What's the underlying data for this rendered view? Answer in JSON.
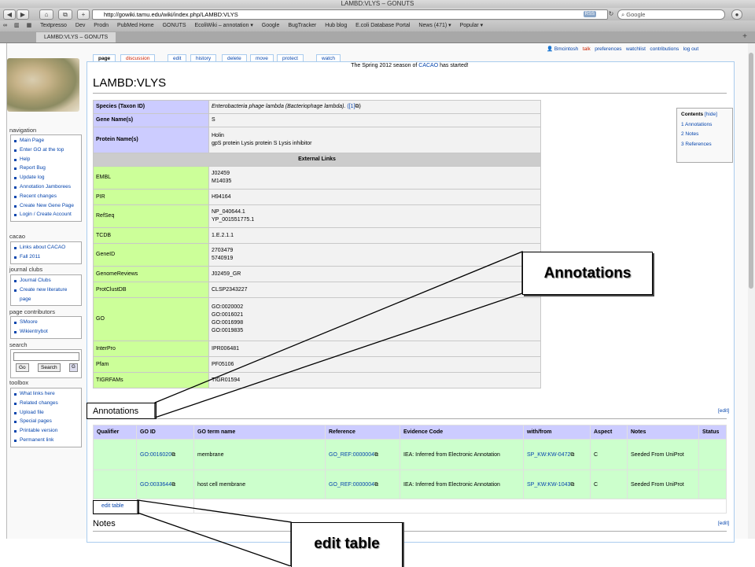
{
  "browser": {
    "window_title": "LAMBD:VLYS – GONUTS",
    "url": "http://gowiki.tamu.edu/wiki/index.php/LAMBD:VLYS",
    "rss": "RSS",
    "search_placeholder": "Google",
    "bookmarks": [
      "Textpresso",
      "Dev",
      "Prodn",
      "PubMed Home",
      "GONUTS",
      "EcoliWiki – annotation ▾",
      "Google",
      "BugTracker",
      "Hub blog",
      "E.coli Database Portal",
      "News (471) ▾",
      "Popular ▾"
    ],
    "tab_label": "LAMBD:VLYS – GONUTS"
  },
  "personal": {
    "user": "Bmcintosh",
    "items": [
      "talk",
      "preferences",
      "watchlist",
      "contributions",
      "log out"
    ]
  },
  "page_tabs": [
    "page",
    "discussion",
    "edit",
    "history",
    "delete",
    "move",
    "protect",
    "watch"
  ],
  "site_notice": {
    "prefix": "The Spring 2012 season of ",
    "link": "CACAO",
    "suffix": " has started!"
  },
  "page_title": "LAMBD:VLYS",
  "sidebar": {
    "navigation": {
      "title": "navigation",
      "items": [
        "Main Page",
        "Enter GO at the top",
        "Help",
        "Report Bug",
        "Update log",
        "Annotation Jamborees",
        "Recent changes",
        "Create New Gene Page",
        "Login / Create Account"
      ]
    },
    "cacao": {
      "title": "cacao",
      "items": [
        "Links about CACAO",
        "Fall 2011"
      ]
    },
    "journal": {
      "title": "journal clubs",
      "items": [
        "Journal Clubs",
        "Create new literature page"
      ]
    },
    "contributors": {
      "title": "page contributors",
      "items": [
        "SMoore",
        "Wikientrybot"
      ]
    },
    "search": {
      "title": "search",
      "go": "Go",
      "search": "Search"
    },
    "toolbox": {
      "title": "toolbox",
      "items": [
        "What links here",
        "Related changes",
        "Upload file",
        "Special pages",
        "Printable version",
        "Permanent link"
      ]
    }
  },
  "infobox": {
    "species_label": "Species (Taxon ID)",
    "species_value": "Enterobacteria phage lambda (Bacteriophage lambda).",
    "species_ref": "([1]",
    "species_ref_close": ")",
    "gene_label": "Gene Name(s)",
    "gene_value": "S",
    "protein_label": "Protein Name(s)",
    "protein_values": [
      "Holin",
      "gpS protein Lysis protein S Lysis inhibitor"
    ],
    "external_links_header": "External Links",
    "links": [
      {
        "label": "EMBL",
        "values": [
          "J02459",
          "M14035"
        ]
      },
      {
        "label": "PIR",
        "values": [
          "H94164"
        ]
      },
      {
        "label": "RefSeq",
        "values": [
          "NP_040644.1",
          "YP_001551775.1"
        ]
      },
      {
        "label": "TCDB",
        "values": [
          "1.E.2.1.1"
        ]
      },
      {
        "label": "GeneID",
        "values": [
          "2703479",
          "5740919"
        ]
      },
      {
        "label": "GenomeReviews",
        "values": [
          "J02459_GR"
        ]
      },
      {
        "label": "ProtClustDB",
        "values": [
          "CLSP2343227"
        ]
      },
      {
        "label": "GO",
        "values": [
          "GO:0020002",
          "GO:0016021",
          "GO:0016998",
          "GO:0019835"
        ]
      },
      {
        "label": "InterPro",
        "values": [
          "IPR006481"
        ]
      },
      {
        "label": "Pfam",
        "values": [
          "PF05106"
        ]
      },
      {
        "label": "TIGRFAMs",
        "values": [
          "TIGR01594"
        ]
      }
    ]
  },
  "toc": {
    "title": "Contents",
    "hide": "[hide]",
    "items": [
      "1 Annotations",
      "2 Notes",
      "3 References"
    ]
  },
  "annotations": {
    "heading": "Annotations",
    "edit": "[edit]",
    "columns": [
      "Qualifier",
      "GO ID",
      "GO term name",
      "Reference",
      "Evidence Code",
      "with/from",
      "Aspect",
      "Notes",
      "Status"
    ],
    "rows": [
      {
        "qualifier": "",
        "go_id": "GO:0016020",
        "term": "membrane",
        "reference": "GO_REF:0000004",
        "evidence": "IEA: Inferred from Electronic Annotation",
        "with_from": "SP_KW:KW-0472",
        "aspect": "C",
        "notes": "Seeded From UniProt",
        "status": ""
      },
      {
        "qualifier": "",
        "go_id": "GO:0033644",
        "term": "host cell membrane",
        "reference": "GO_REF:0000004",
        "evidence": "IEA: Inferred from Electronic Annotation",
        "with_from": "SP_KW:KW-1043",
        "aspect": "C",
        "notes": "Seeded From UniProt",
        "status": ""
      }
    ],
    "edit_table": "edit table"
  },
  "notes": {
    "heading": "Notes",
    "edit": "[edit]"
  },
  "callouts": {
    "annotations": "Annotations",
    "edit_table": "edit table"
  }
}
